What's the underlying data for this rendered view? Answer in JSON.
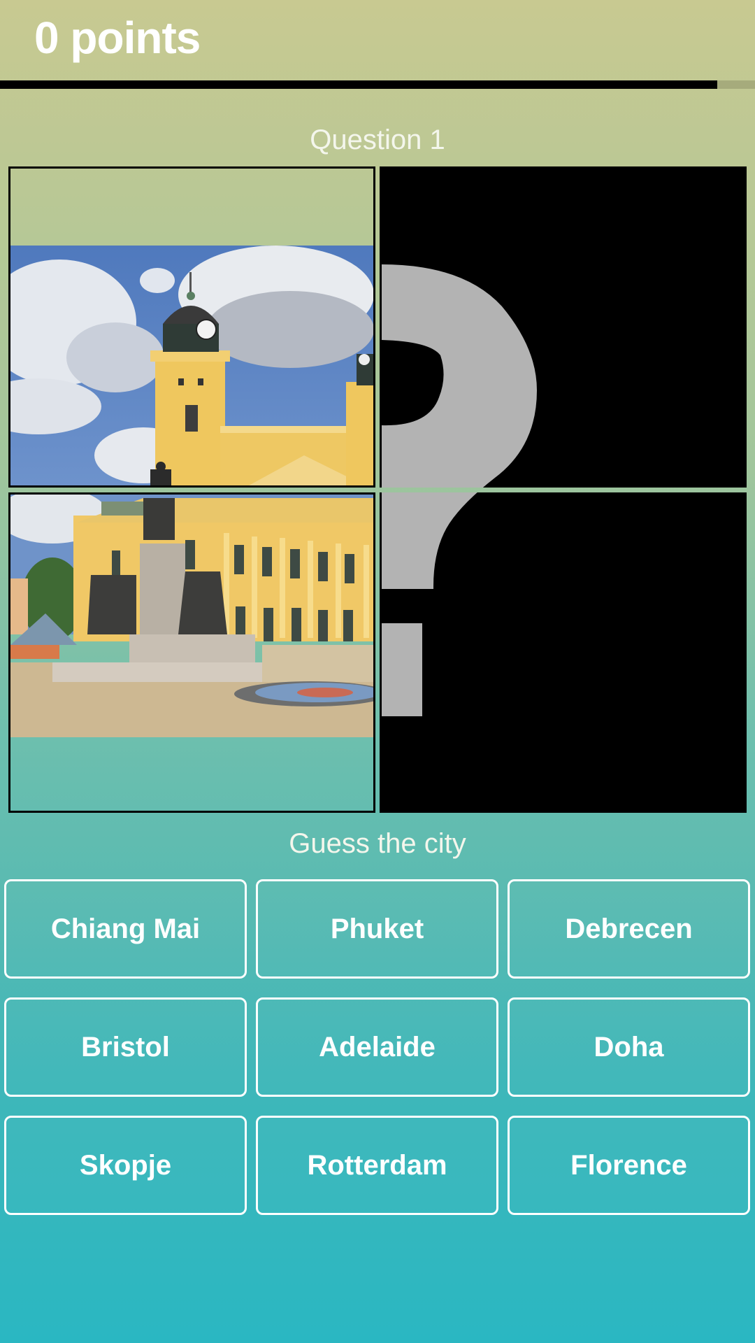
{
  "header": {
    "score_label": "0 points",
    "timer_progress_fraction": 0.95
  },
  "question": {
    "label": "Question 1",
    "prompt": "Guess the city"
  },
  "tiles": [
    {
      "state": "revealed",
      "content": "photo of yellow church with clock towers under cloudy blue sky (top half)"
    },
    {
      "state": "hidden",
      "icon": "question-mark-icon"
    },
    {
      "state": "revealed",
      "content": "photo of yellow church facade with statue monument and paved square (bottom half)"
    },
    {
      "state": "hidden",
      "icon": "question-mark-icon"
    }
  ],
  "answers": [
    {
      "label": "Chiang Mai"
    },
    {
      "label": "Phuket"
    },
    {
      "label": "Debrecen"
    },
    {
      "label": "Bristol"
    },
    {
      "label": "Adelaide"
    },
    {
      "label": "Doha"
    },
    {
      "label": "Skopje"
    },
    {
      "label": "Rotterdam"
    },
    {
      "label": "Florence"
    }
  ],
  "colors": {
    "background_top": "#c8c991",
    "background_bottom": "#2ab7c2",
    "timer_fill": "#000000",
    "timer_track": "#a6ab7c",
    "hidden_tile": "#000000",
    "question_mark": "#b3b3b3",
    "button_border": "#ffffff"
  }
}
